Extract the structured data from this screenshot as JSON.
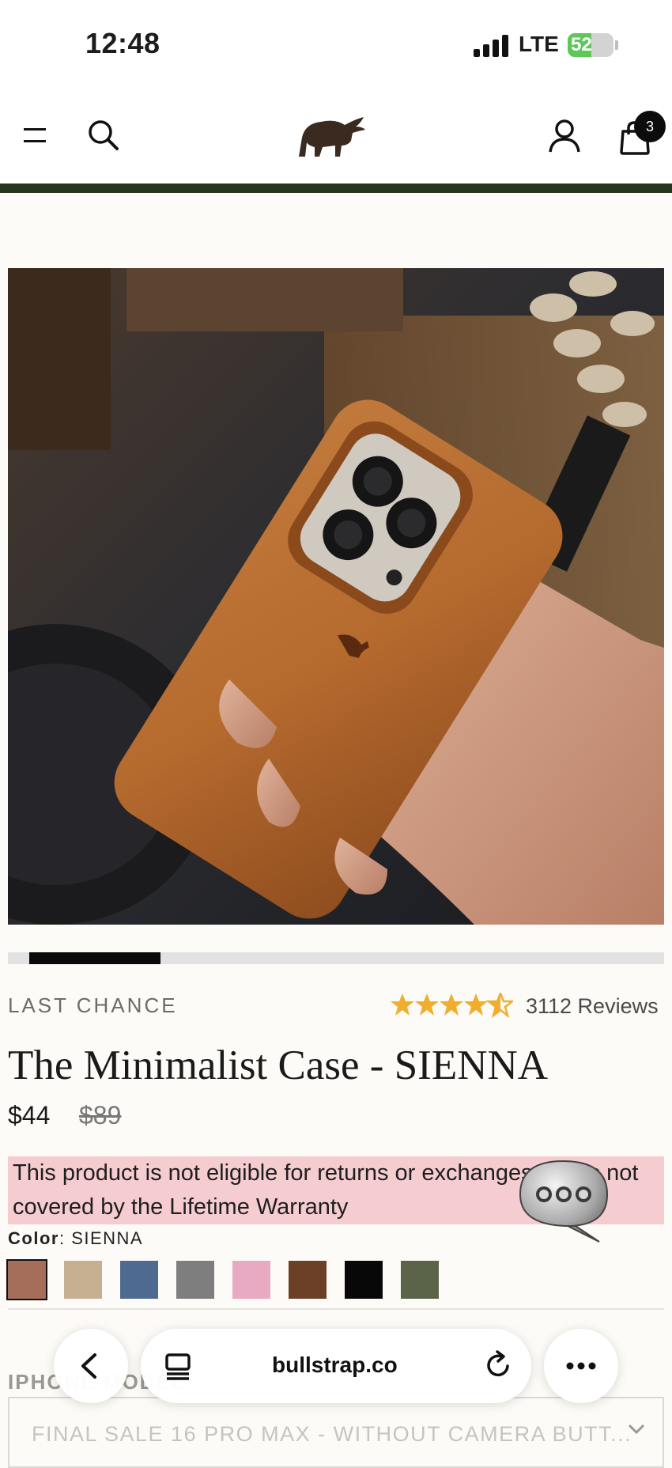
{
  "status_bar": {
    "time": "12:48",
    "network": "LTE",
    "battery": "52",
    "battery_level": 0.52
  },
  "header": {
    "menu_icon": "hamburger-icon",
    "search_icon": "search-icon",
    "logo_icon": "bull-logo-icon",
    "account_icon": "user-icon",
    "cart_icon": "shopping-bag-icon",
    "cart_count": "3"
  },
  "gallery": {
    "image_icon": "product-photo-leather-phone-case",
    "position": 0.12
  },
  "product": {
    "badge": "LAST CHANCE",
    "rating": 4.5,
    "reviews": "3112 Reviews",
    "title": "The Minimalist Case - SIENNA",
    "price": "$44",
    "compare_price": "$89",
    "notice": "This product is not eligible for returns or exchanges and is not covered by the Lifetime Warranty",
    "color_label": "Color",
    "color_value": "SIENNA",
    "swatches": [
      "#a46e5a",
      "#c7b091",
      "#4e6a90",
      "#7e7e7e",
      "#e8a9c2",
      "#6b4026",
      "#080808",
      "#5b6348"
    ],
    "selected_swatch": 0,
    "variant_label": "IPHONE MODEL",
    "variant_value": "FINAL SALE 16 PRO MAX - WITHOUT CAMERA BUTT..."
  },
  "browser": {
    "url": "bullstrap.co",
    "back_icon": "chevron-left-icon",
    "tabs_icon": "tabs-icon",
    "reload_icon": "reload-icon",
    "more_icon": "more-icon"
  },
  "chat": {
    "icon": "chat-bubble-icon"
  },
  "colors": {
    "accent": "#24361f",
    "notice_bg": "#f5ccd0",
    "star": "#f0ad2e"
  }
}
